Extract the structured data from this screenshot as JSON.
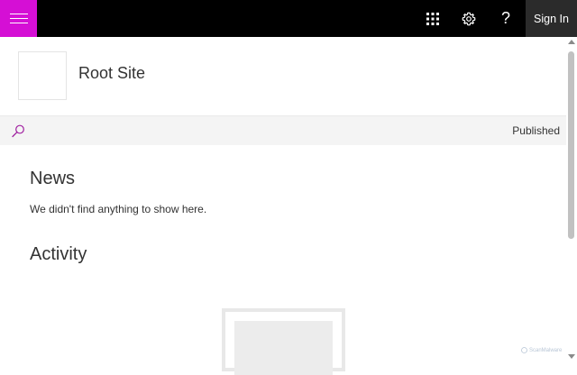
{
  "suitebar": {
    "menu_icon": "hamburger-icon",
    "apps_icon": "app-launcher-icon",
    "settings_icon": "gear-icon",
    "help_icon": "help-icon",
    "help_glyph": "?",
    "signin_label": "Sign In",
    "accent_color": "#d50fd5"
  },
  "site": {
    "title": "Root Site"
  },
  "commandbar": {
    "search_icon": "search-icon",
    "status": "Published"
  },
  "news": {
    "title": "News",
    "empty_message": "We didn't find anything to show here."
  },
  "activity": {
    "title": "Activity"
  },
  "watermark": {
    "text": "ScanMalware"
  }
}
